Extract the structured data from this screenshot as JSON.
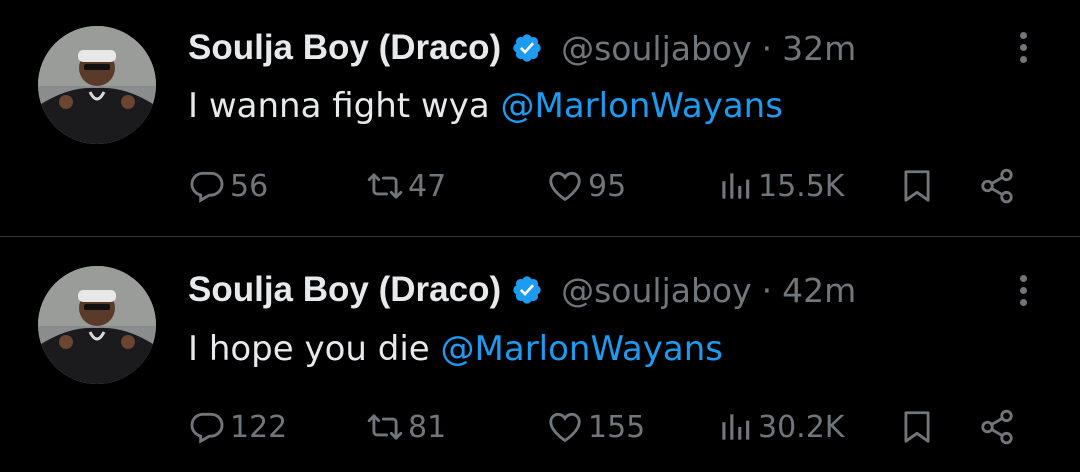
{
  "tweets": [
    {
      "author_name": "Soulja Boy (Draco)",
      "handle": "@souljaboy",
      "separator": "·",
      "time": "32m",
      "text": "I wanna fight wya ",
      "mention": "@MarlonWayans",
      "replies": "56",
      "retweets": "47",
      "likes": "95",
      "views": "15.5K"
    },
    {
      "author_name": "Soulja Boy (Draco)",
      "handle": "@souljaboy",
      "separator": "·",
      "time": "42m",
      "text": "I hope you die ",
      "mention": "@MarlonWayans",
      "replies": "122",
      "retweets": "81",
      "likes": "155",
      "views": "30.2K"
    }
  ],
  "colors": {
    "background": "#000000",
    "text_primary": "#e7e9ea",
    "text_secondary": "#71767b",
    "link": "#1d9bf0",
    "verified_badge": "#1d9bf0"
  },
  "icons": {
    "verified": "verified-badge-icon",
    "more": "more-vertical-icon",
    "reply": "reply-bubble-icon",
    "retweet": "retweet-arrows-icon",
    "like": "heart-icon",
    "views": "views-bars-icon",
    "bookmark": "bookmark-icon",
    "share": "share-icon"
  }
}
